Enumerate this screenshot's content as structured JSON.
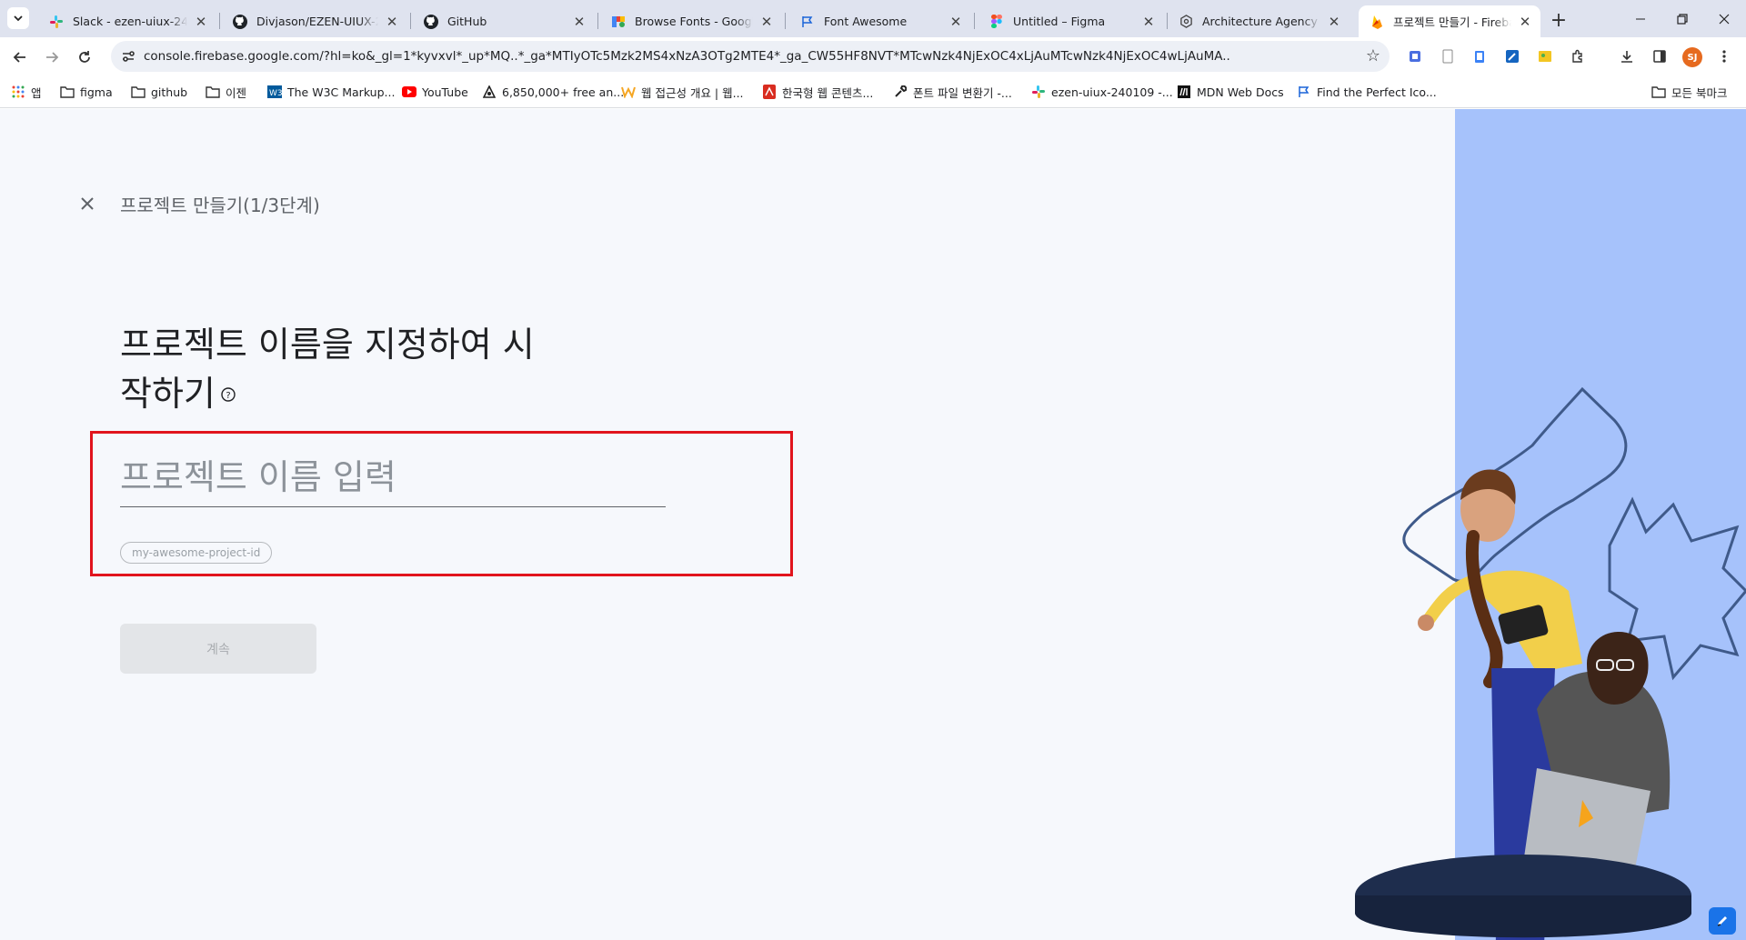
{
  "browser": {
    "tabs": [
      {
        "title": "Slack - ezen-uiux-240109",
        "icon": "slack-icon",
        "active": false
      },
      {
        "title": "Divjason/EZEN-UIUX-240",
        "icon": "github-icon",
        "active": false
      },
      {
        "title": "GitHub",
        "icon": "github-icon",
        "active": false
      },
      {
        "title": "Browse Fonts - Google F",
        "icon": "google-fonts-icon",
        "active": false
      },
      {
        "title": "Font Awesome",
        "icon": "flag-icon",
        "active": false
      },
      {
        "title": "Untitled – Figma",
        "icon": "figma-icon",
        "active": false
      },
      {
        "title": "Architecture Agency",
        "icon": "gear-icon",
        "active": false
      },
      {
        "title": "프로젝트 만들기 - Fireba",
        "icon": "firebase-icon",
        "active": true
      }
    ],
    "url": "console.firebase.google.com/?hl=ko&_gl=1*kyvxvl*_up*MQ..*_ga*MTIyOTc5Mzk2MS4xNzA3OTg2MTE4*_ga_CW55HF8NVT*MTcwNzk4NjExOC4xLjAuMTcwNzk4NjExOC4wLjAuMA..",
    "profile_initials": "SJ",
    "bookmarks": [
      {
        "label": "앱",
        "icon": "apps-grid-icon"
      },
      {
        "label": "figma",
        "icon": "folder-icon"
      },
      {
        "label": "github",
        "icon": "folder-icon"
      },
      {
        "label": "이젠",
        "icon": "folder-icon"
      },
      {
        "label": "The W3C Markup...",
        "icon": "w3c-icon"
      },
      {
        "label": "YouTube",
        "icon": "youtube-icon"
      },
      {
        "label": "6,850,000+ free an...",
        "icon": "flaticon-icon"
      },
      {
        "label": "웹 접근성 개요 | 웹...",
        "icon": "w-logo-icon"
      },
      {
        "label": "한국형 웹 콘텐츠...",
        "icon": "pdf-icon"
      },
      {
        "label": "폰트 파일 변환기 -...",
        "icon": "wrench-icon"
      },
      {
        "label": "ezen-uiux-240109 -...",
        "icon": "slack-icon"
      },
      {
        "label": "MDN Web Docs",
        "icon": "mdn-icon"
      },
      {
        "label": "Find the Perfect Ico...",
        "icon": "flag-icon"
      }
    ],
    "all_bookmarks": "모든 북마크"
  },
  "page": {
    "step_title": "프로젝트 만들기(1/3단계)",
    "heading_line1": "프로젝트 이름을 지정하여 시",
    "heading_line2": "작하기",
    "help_glyph": "?",
    "name_placeholder": "프로젝트 이름 입력",
    "project_id_chip": "my-awesome-project-id",
    "continue_label": "계속"
  },
  "colors": {
    "page_bg": "#f6f8fc",
    "side_panel": "#a6c2fb",
    "highlight": "#e1141d",
    "firebase_orange": "#f6a41c"
  }
}
